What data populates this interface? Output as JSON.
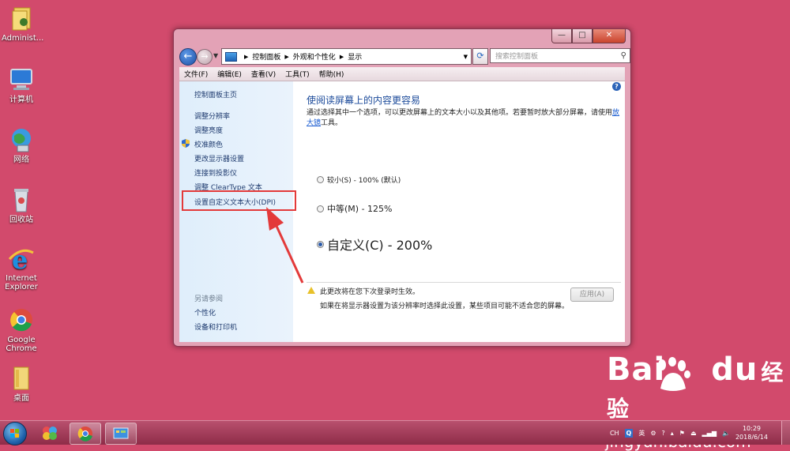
{
  "desktop": {
    "icons": [
      {
        "label": "Administ..."
      },
      {
        "label": "计算机"
      },
      {
        "label": "网络"
      },
      {
        "label": "回收站"
      },
      {
        "label": "Internet Explorer"
      },
      {
        "label": "Google Chrome"
      },
      {
        "label": "桌面"
      }
    ]
  },
  "window": {
    "buttons": {
      "minimize": "—",
      "maximize": "□",
      "close": "✕"
    },
    "address": {
      "crumbs": [
        "控制面板",
        "外观和个性化",
        "显示"
      ]
    },
    "search_placeholder": "搜索控制面板",
    "menu": [
      "文件(F)",
      "编辑(E)",
      "查看(V)",
      "工具(T)",
      "帮助(H)"
    ],
    "sidebar": {
      "home": "控制面板主页",
      "links": [
        "调整分辨率",
        "调整亮度",
        "校准颜色",
        "更改显示器设置",
        "连接到投影仪",
        "调整 ClearType 文本",
        "设置自定义文本大小(DPI)"
      ],
      "see_also": "另请参阅",
      "see_also_links": [
        "个性化",
        "设备和打印机"
      ]
    },
    "content": {
      "title": "使阅读屏幕上的内容更容易",
      "desc_before": "通过选择其中一个选项，可以更改屏幕上的文本大小以及其他项。若要暂时放大部分屏幕，请使用",
      "desc_link": "放大镜",
      "desc_after": "工具。",
      "options": [
        {
          "label": "较小(S) - 100% (默认)",
          "checked": false
        },
        {
          "label": "中等(M) - 125%",
          "checked": false
        },
        {
          "label": "自定义(C) - 200%",
          "checked": true
        }
      ],
      "warning": "此更改将在您下次登录时生效。",
      "warning_sub": "如果在将显示器设置为该分辨率时选择此设置，某些项目可能不适合您的屏幕。",
      "apply": "应用(A)"
    }
  },
  "taskbar": {
    "tray": {
      "lang": "CH",
      "ime": "英",
      "time": "10:29",
      "date": "2018/6/14"
    }
  },
  "watermark": {
    "brand": "Bai",
    "brand2": "du",
    "brand_cn": "经验",
    "url": "jingyan.baidu.com"
  }
}
